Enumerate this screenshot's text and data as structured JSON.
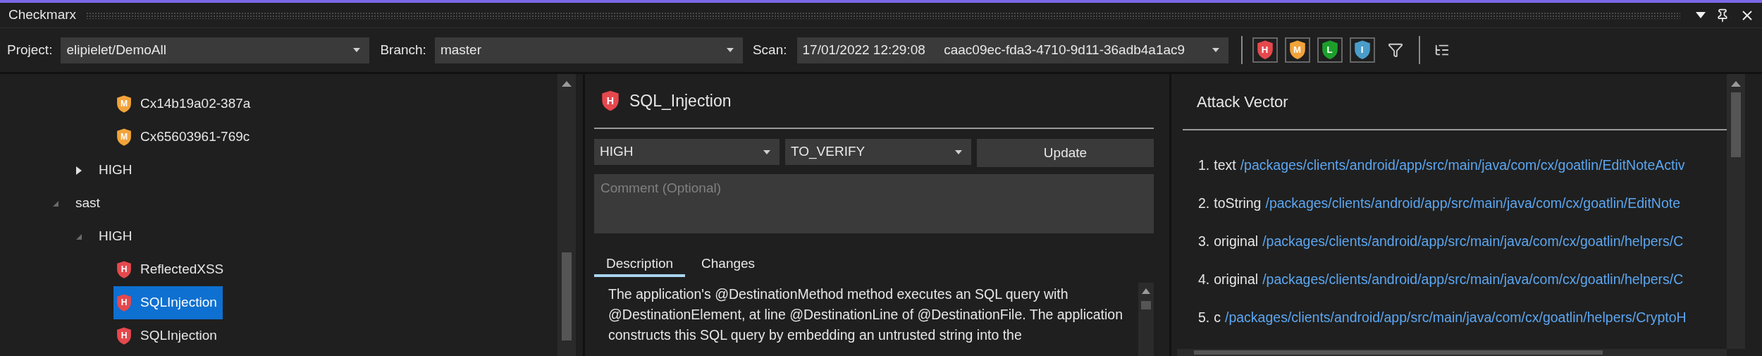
{
  "window": {
    "title": "Checkmarx"
  },
  "toolbar": {
    "project": {
      "label": "Project:",
      "value": "elipielet/DemoAll"
    },
    "branch": {
      "label": "Branch:",
      "value": "master"
    },
    "scan": {
      "label": "Scan:",
      "value": "17/01/2022 12:29:08     caac09ec-fda3-4710-9d11-36adb4a1ac9"
    },
    "severity_filters": [
      {
        "badge": "H",
        "color": "#e5484d"
      },
      {
        "badge": "M",
        "color": "#f2a33a"
      },
      {
        "badge": "L",
        "color": "#1d9e2c"
      },
      {
        "badge": "I",
        "color": "#4a9cc9"
      }
    ]
  },
  "tree": [
    {
      "children": [
        {
          "children": [
            {
              "label": "Cx14b19a02-387a",
              "badge": "M",
              "color": "#f2a33a",
              "selected": false
            },
            {
              "label": "Cx65603961-769c",
              "badge": "M",
              "color": "#f2a33a",
              "selected": false
            }
          ]
        },
        {
          "label": "HIGH",
          "expanded": false
        }
      ]
    },
    {
      "label": "sast",
      "expanded": true,
      "children": [
        {
          "label": "HIGH",
          "expanded": true,
          "children": [
            {
              "label": "ReflectedXSS",
              "badge": "H",
              "color": "#e5484d",
              "selected": false
            },
            {
              "label": "SQLInjection",
              "badge": "H",
              "color": "#e5484d",
              "selected": true
            },
            {
              "label": "SQLInjection",
              "badge": "H",
              "color": "#e5484d",
              "selected": false
            }
          ]
        }
      ]
    }
  ],
  "details": {
    "title": "SQL_Injection",
    "badge": "H",
    "color": "#e5484d",
    "severity_select": "HIGH",
    "state_select": "TO_VERIFY",
    "update_button": "Update",
    "comment": {
      "placeholder": "Comment (Optional)"
    },
    "tabs": [
      {
        "label": "Description",
        "selected": true
      },
      {
        "label": "Changes",
        "selected": false
      }
    ],
    "description": "The application's @DestinationMethod method executes an SQL query with @DestinationElement, at line @DestinationLine of @DestinationFile. The application constructs this SQL query by embedding an untrusted string into the"
  },
  "attack_vector": {
    "title": "Attack Vector",
    "nodes": [
      {
        "number": "1.",
        "name": "text",
        "path": "/packages/clients/android/app/src/main/java/com/cx/goatlin/EditNoteActiv"
      },
      {
        "number": "2.",
        "name": "toString",
        "path": "/packages/clients/android/app/src/main/java/com/cx/goatlin/EditNote"
      },
      {
        "number": "3.",
        "name": "original",
        "path": "/packages/clients/android/app/src/main/java/com/cx/goatlin/helpers/C"
      },
      {
        "number": "4.",
        "name": "original",
        "path": "/packages/clients/android/app/src/main/java/com/cx/goatlin/helpers/C"
      },
      {
        "number": "5.",
        "name": "c",
        "path": "/packages/clients/android/app/src/main/java/com/cx/goatlin/helpers/CryptoH"
      }
    ]
  }
}
